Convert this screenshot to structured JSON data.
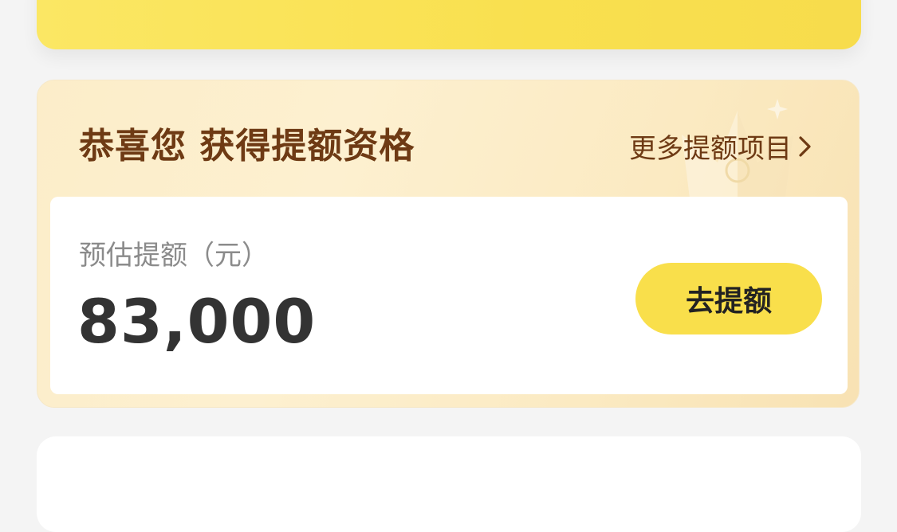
{
  "promo": {
    "title": "恭喜您 获得提额资格",
    "more_link": "更多提额项目",
    "amount_label": "预估提额（元）",
    "amount_value": "83,000",
    "cta_label": "去提额"
  },
  "colors": {
    "brand_yellow": "#f9df4b",
    "title_brown": "#6e3a14",
    "amount_text": "#333333",
    "label_gray": "#8b8b8b"
  },
  "icons": {
    "more": "chevron-right-icon",
    "decoration": "crown-icon"
  }
}
